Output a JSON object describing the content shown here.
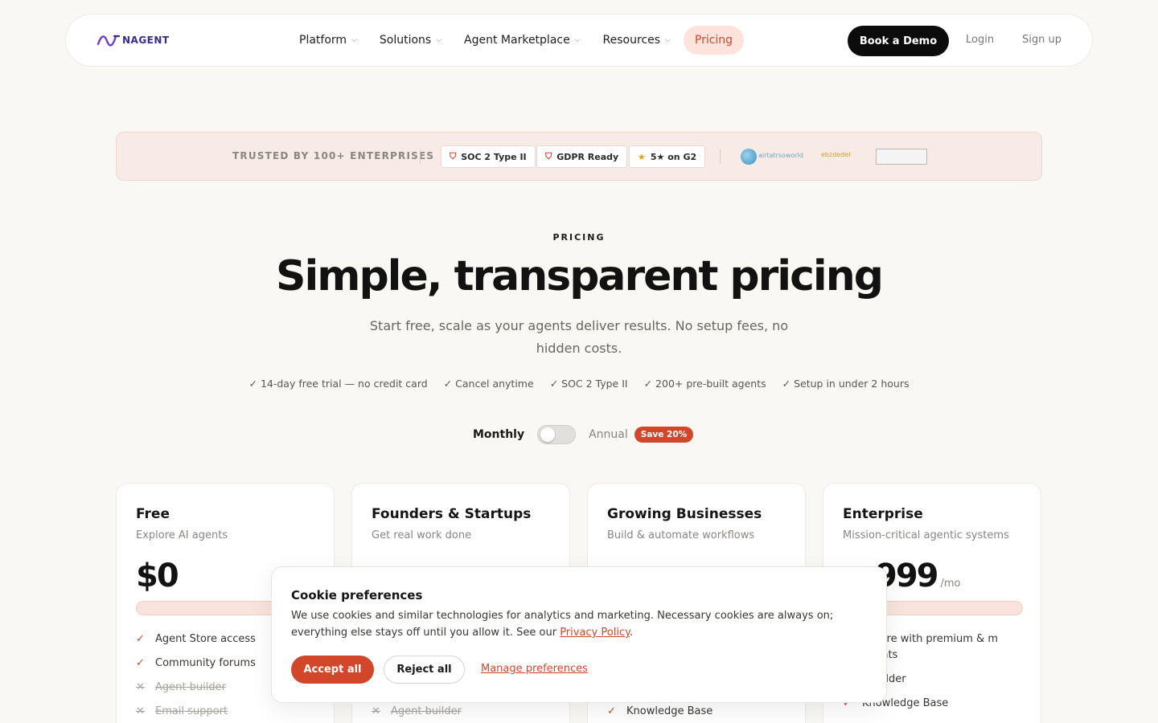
{
  "nav": {
    "logo_text": "NAGENT",
    "links": [
      {
        "label": "Platform",
        "has_menu": true
      },
      {
        "label": "Solutions",
        "has_menu": true
      },
      {
        "label": "Agent Marketplace",
        "has_menu": true
      },
      {
        "label": "Resources",
        "has_menu": true
      },
      {
        "label": "Pricing",
        "has_menu": false
      }
    ],
    "chevron": "⌵",
    "demo_label": "Book a Demo",
    "login_label": "Login",
    "signup_label": "Sign up",
    "accent": "#d2462a"
  },
  "trust": {
    "label": "TRUSTED BY 100+ ENTERPRISES",
    "badges": [
      {
        "icon": "shield-icon",
        "glyph": "⛉",
        "label": "SOC 2 Type II"
      },
      {
        "icon": "shield-icon",
        "glyph": "⛉",
        "label": "GDPR Ready"
      },
      {
        "icon": "star-icon",
        "glyph": "★",
        "label": "5★ on G2"
      }
    ],
    "logo1_text": "airtatrsoworld",
    "logo2_text": "ebzdedel"
  },
  "hero": {
    "eyebrow": "PRICING",
    "title": "Simple, transparent pricing",
    "subtitle": "Start free, scale as your agents deliver results. No setup fees, no hidden costs.",
    "checks": [
      "✓ 14-day free trial — no credit card",
      "✓ Cancel anytime",
      "✓ SOC 2 Type II",
      "✓ 200+ pre-built agents",
      "✓ Setup in under 2 hours"
    ]
  },
  "billing": {
    "monthly_label": "Monthly",
    "annual_label": "Annual",
    "save_label": "Save 20%",
    "annual_selected": false
  },
  "plans": [
    {
      "name": "Free",
      "desc": "Explore AI agents",
      "price": "$0",
      "per": "",
      "features": [
        {
          "text": "Agent Store access",
          "included": true
        },
        {
          "text": "Community forums",
          "included": true
        },
        {
          "text": "Agent builder",
          "included": false
        },
        {
          "text": "Email support",
          "included": false
        }
      ]
    },
    {
      "name": "Founders & Startups",
      "desc": "Get real work done",
      "price": "",
      "per": "",
      "features": [
        {
          "text": "",
          "included": true
        },
        {
          "text": "",
          "included": true
        },
        {
          "text": "",
          "included": true
        },
        {
          "text": "Agent builder",
          "included": false
        }
      ]
    },
    {
      "name": "Growing Businesses",
      "desc": "Build & automate workflows",
      "price": "",
      "per": "",
      "features": [
        {
          "text": "",
          "included": true
        },
        {
          "text": "",
          "included": true
        },
        {
          "text": "",
          "included": true
        },
        {
          "text": "Knowledge Base",
          "included": true
        }
      ]
    },
    {
      "name": "Enterprise",
      "desc": "Mission-critical agentic systems",
      "price": "999",
      "per": "/mo",
      "features": [
        {
          "text": "t Store with premium & m agents",
          "included": true
        },
        {
          "text": "t builder",
          "included": true
        },
        {
          "text": "Knowledge Base",
          "included": true
        }
      ]
    }
  ],
  "cookie": {
    "title": "Cookie preferences",
    "text": "We use cookies and similar technologies for analytics and marketing. Necessary cookies are always on; everything else stays off until you allow it. See our",
    "policy_label": "Privacy Policy",
    "accept_label": "Accept all",
    "reject_label": "Reject all",
    "manage_label": "Manage preferences"
  }
}
